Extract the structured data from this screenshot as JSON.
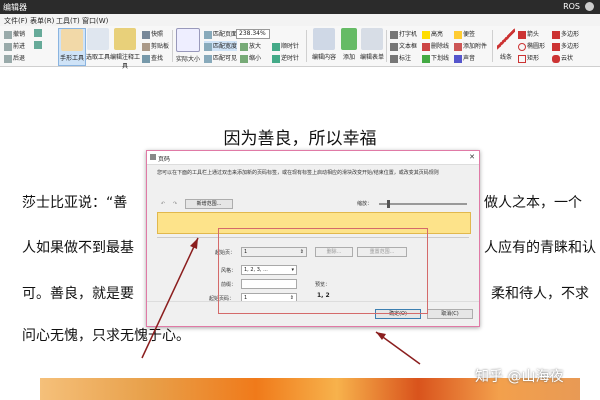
{
  "window": {
    "title": "编辑器",
    "user": "ROS"
  },
  "menubar": {
    "items": [
      "文件(F)",
      "表单(R)",
      "工具(T)",
      "窗口(W)"
    ]
  },
  "ribbon": {
    "left_group": [
      "撤销",
      "前进",
      "后退"
    ],
    "tools": {
      "hand": "手形工具",
      "select_text": "选取工具",
      "edit_annotation": "编辑注释工具",
      "snapshot": "快照",
      "clipboard": "剪贴板",
      "search": "查找",
      "actual_size": "实际大小",
      "fit_page": "匹配页面",
      "fit_width": "匹配宽度",
      "fit_visible": "匹配可见",
      "zoom_value": "238.34%",
      "zoom_in": "放大",
      "zoom_out": "缩小",
      "rotate_cw": "顺时针",
      "rotate_ccw": "逆时针",
      "edit_content": "编辑内容",
      "add": "添加",
      "edit_form": "编辑表单",
      "typewriter": "打字机",
      "textbox": "文本框",
      "callout": "标注",
      "highlight": "高亮",
      "strikeout": "删除线",
      "underline": "下划线",
      "note": "便签",
      "attach": "添加附件",
      "sound": "声音",
      "line": "线条",
      "arrow": "箭头",
      "ellipse": "椭圆形",
      "rect": "矩形",
      "polyline": "多边形",
      "polygon": "多边形",
      "cloud": "云状"
    }
  },
  "document": {
    "title": "因为善良，所以幸福",
    "lines": [
      "莎士比亚说：“善",
      "做人之本，一个",
      "人如果做不到最基",
      "人应有的青睐和认",
      "可。善良，就是要",
      "柔和待人，不求",
      "问心无愧，只求无愧于心。"
    ]
  },
  "dialog": {
    "title": "页码",
    "description": "您可以在下面的工具栏上通过双击来添加新的页码标签，或在现有标签上启动相应的滑块改变开始/结束位置，或改变其页码规则",
    "new_range": "新增范围...",
    "zoom_label": "缩放：",
    "start_page_label": "起始页：",
    "start_page_value": "1",
    "delete": "删除...",
    "reset_range": "重置范围...",
    "style_label": "风格：",
    "style_value": "1, 2, 3, ...",
    "prefix_label": "前缀：",
    "prefix_value": "",
    "start_number_label": "起始页码：",
    "start_number_value": "1",
    "preview_label": "预览：",
    "preview_value": "1, 2",
    "ok": "确定(O)",
    "cancel": "取消(C)"
  },
  "watermark": "知乎 @山海夜",
  "colors": {
    "dialog_border": "#e07aa6",
    "thumb_strip": "#fde38a",
    "annotation_red": "#d46a6a"
  }
}
